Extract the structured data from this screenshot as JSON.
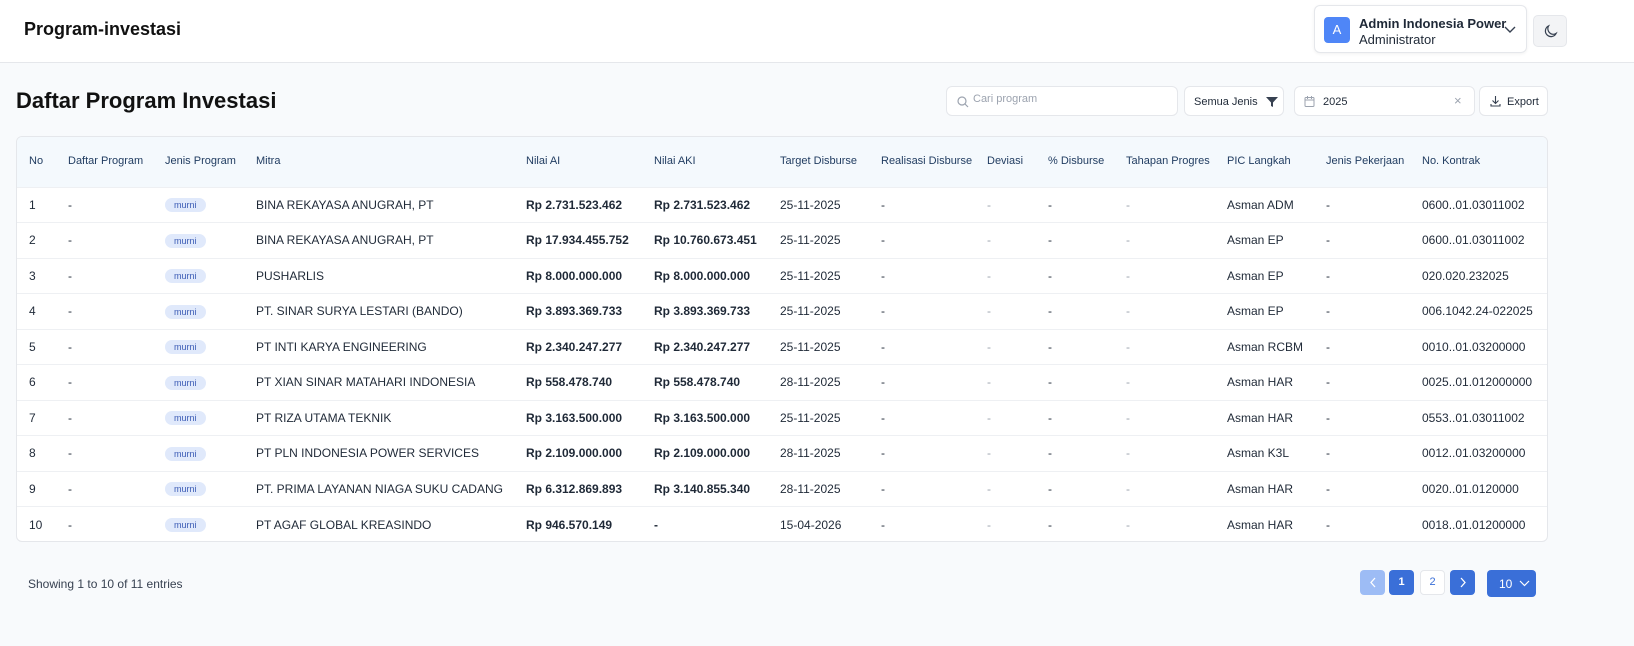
{
  "app": {
    "title": "Program-investasi"
  },
  "user": {
    "initial": "A",
    "name": "Admin Indonesia Power",
    "role": "Administrator"
  },
  "page": {
    "title": "Daftar Program Investasi"
  },
  "toolbar": {
    "search_placeholder": "Cari program",
    "search_value": "",
    "filter_label": "Semua Jenis",
    "year": "2025",
    "export_label": "Export"
  },
  "table": {
    "headers": [
      "No",
      "Daftar Program",
      "Jenis Program",
      "Mitra",
      "Nilai AI",
      "Nilai AKI",
      "Target Disburse",
      "Realisasi Disburse",
      "Deviasi",
      "% Disburse",
      "Tahapan Progres",
      "PIC Langkah",
      "Jenis Pekerjaan",
      "No. Kontrak"
    ],
    "rows": [
      [
        "1",
        "-",
        "murni",
        "BINA REKAYASA ANUGRAH, PT",
        "Rp 2.731.523.462",
        "Rp 2.731.523.462",
        "25-11-2025",
        "-",
        "-",
        "-",
        "-",
        "Asman ADM",
        "-",
        "0600..01.03011002"
      ],
      [
        "2",
        "-",
        "murni",
        "BINA REKAYASA ANUGRAH, PT",
        "Rp 17.934.455.752",
        "Rp 10.760.673.451",
        "25-11-2025",
        "-",
        "-",
        "-",
        "-",
        "Asman EP",
        "-",
        "0600..01.03011002"
      ],
      [
        "3",
        "-",
        "murni",
        "PUSHARLIS",
        "Rp 8.000.000.000",
        "Rp 8.000.000.000",
        "25-11-2025",
        "-",
        "-",
        "-",
        "-",
        "Asman EP",
        "-",
        "020.020.232025"
      ],
      [
        "4",
        "-",
        "murni",
        "PT. SINAR SURYA LESTARI (BANDO)",
        "Rp 3.893.369.733",
        "Rp 3.893.369.733",
        "25-11-2025",
        "-",
        "-",
        "-",
        "-",
        "Asman EP",
        "-",
        "006.1042.24-022025"
      ],
      [
        "5",
        "-",
        "murni",
        "PT INTI KARYA ENGINEERING",
        "Rp 2.340.247.277",
        "Rp 2.340.247.277",
        "25-11-2025",
        "-",
        "-",
        "-",
        "-",
        "Asman RCBM",
        "-",
        "0010..01.03200000"
      ],
      [
        "6",
        "-",
        "murni",
        "PT XIAN SINAR MATAHARI INDONESIA",
        "Rp 558.478.740",
        "Rp 558.478.740",
        "28-11-2025",
        "-",
        "-",
        "-",
        "-",
        "Asman HAR",
        "-",
        "0025..01.012000000"
      ],
      [
        "7",
        "-",
        "murni",
        "PT RIZA UTAMA TEKNIK",
        "Rp 3.163.500.000",
        "Rp 3.163.500.000",
        "25-11-2025",
        "-",
        "-",
        "-",
        "-",
        "Asman HAR",
        "-",
        "0553..01.03011002"
      ],
      [
        "8",
        "-",
        "murni",
        "PT PLN INDONESIA POWER SERVICES",
        "Rp 2.109.000.000",
        "Rp 2.109.000.000",
        "28-11-2025",
        "-",
        "-",
        "-",
        "-",
        "Asman K3L",
        "-",
        "0012..01.03200000"
      ],
      [
        "9",
        "-",
        "murni",
        "PT. PRIMA LAYANAN NIAGA SUKU CADANG",
        "Rp 6.312.869.893",
        "Rp 3.140.855.340",
        "28-11-2025",
        "-",
        "-",
        "-",
        "-",
        "Asman HAR",
        "-",
        "0020..01.0120000"
      ],
      [
        "10",
        "-",
        "murni",
        "PT AGAF GLOBAL KREASINDO",
        "Rp 946.570.149",
        "-",
        "15-04-2026",
        "-",
        "-",
        "-",
        "-",
        "Asman HAR",
        "-",
        "0018..01.01200000"
      ]
    ]
  },
  "footer": {
    "showing": "Showing 1 to 10 of 11 entries",
    "pages": [
      "1",
      "2"
    ],
    "current_page": 1,
    "page_size": "10"
  }
}
